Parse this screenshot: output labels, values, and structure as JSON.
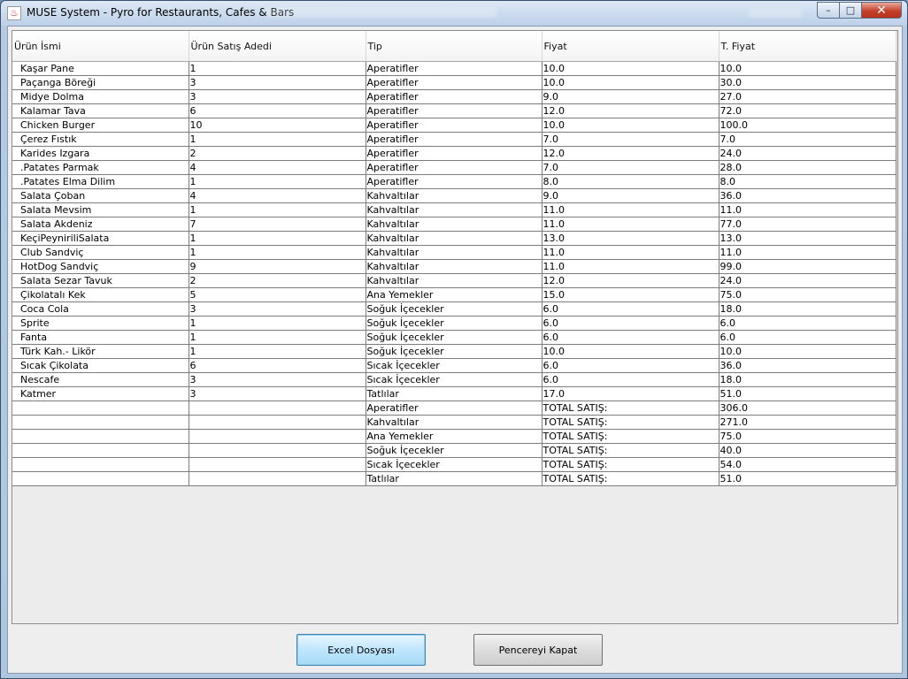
{
  "window": {
    "title": "MUSE System - Pyro for Restaurants, Cafes & Bars",
    "app_icon": "java-cup-icon",
    "controls": {
      "minimize": "–",
      "maximize": "□",
      "close": "✕"
    }
  },
  "table": {
    "columns": [
      "Ürün İsmi",
      "Ürün Satış Adedi",
      "Tip",
      "Fiyat",
      "T. Fiyat"
    ],
    "rows": [
      [
        "Kaşar Pane",
        "1",
        "Aperatifler",
        "10.0",
        "10.0"
      ],
      [
        "Paçanga Böreği",
        "3",
        "Aperatifler",
        "10.0",
        "30.0"
      ],
      [
        "Midye Dolma",
        "3",
        "Aperatifler",
        "9.0",
        "27.0"
      ],
      [
        "Kalamar Tava",
        "6",
        "Aperatifler",
        "12.0",
        "72.0"
      ],
      [
        "Chicken Burger",
        "10",
        "Aperatifler",
        "10.0",
        "100.0"
      ],
      [
        "Çerez Fıstık",
        "1",
        "Aperatifler",
        "7.0",
        "7.0"
      ],
      [
        "Karides Izgara",
        "2",
        "Aperatifler",
        "12.0",
        "24.0"
      ],
      [
        ".Patates Parmak",
        "4",
        "Aperatifler",
        "7.0",
        "28.0"
      ],
      [
        ".Patates Elma Dilim",
        "1",
        "Aperatifler",
        "8.0",
        "8.0"
      ],
      [
        "Salata Çoban",
        "4",
        "Kahvaltılar",
        "9.0",
        "36.0"
      ],
      [
        "Salata Mevsim",
        "1",
        "Kahvaltılar",
        "11.0",
        "11.0"
      ],
      [
        "Salata Akdeniz",
        "7",
        "Kahvaltılar",
        "11.0",
        "77.0"
      ],
      [
        "KeçiPeyniriliSalata",
        "1",
        "Kahvaltılar",
        "13.0",
        "13.0"
      ],
      [
        "Club Sandviç",
        "1",
        "Kahvaltılar",
        "11.0",
        "11.0"
      ],
      [
        "HotDog Sandviç",
        "9",
        "Kahvaltılar",
        "11.0",
        "99.0"
      ],
      [
        "Salata Sezar Tavuk",
        "2",
        "Kahvaltılar",
        "12.0",
        "24.0"
      ],
      [
        "Çikolatalı Kek",
        "5",
        "Ana Yemekler",
        "15.0",
        "75.0"
      ],
      [
        "Coca Cola",
        "3",
        "Soğuk İçecekler",
        "6.0",
        "18.0"
      ],
      [
        "Sprite",
        "1",
        "Soğuk İçecekler",
        "6.0",
        "6.0"
      ],
      [
        "Fanta",
        "1",
        "Soğuk İçecekler",
        "6.0",
        "6.0"
      ],
      [
        "Türk Kah.- Likör",
        "1",
        "Soğuk İçecekler",
        "10.0",
        "10.0"
      ],
      [
        "Sıcak Çikolata",
        "6",
        "Sıcak İçecekler",
        "6.0",
        "36.0"
      ],
      [
        "Nescafe",
        "3",
        "Sıcak İçecekler",
        "6.0",
        "18.0"
      ],
      [
        "Katmer",
        "3",
        "Tatlılar",
        "17.0",
        "51.0"
      ],
      [
        "",
        "",
        "Aperatifler",
        "TOTAL SATIŞ:",
        "306.0"
      ],
      [
        "",
        "",
        "Kahvaltılar",
        "TOTAL SATIŞ:",
        "271.0"
      ],
      [
        "",
        "",
        "Ana Yemekler",
        "TOTAL SATIŞ:",
        "75.0"
      ],
      [
        "",
        "",
        "Soğuk İçecekler",
        "TOTAL SATIŞ:",
        "40.0"
      ],
      [
        "",
        "",
        "Sıcak İçecekler",
        "TOTAL SATIŞ:",
        "54.0"
      ],
      [
        "",
        "",
        "Tatlılar",
        "TOTAL SATIŞ:",
        "51.0"
      ]
    ]
  },
  "buttons": {
    "excel": "Excel Dosyası",
    "close": "Pencereyi Kapat"
  }
}
